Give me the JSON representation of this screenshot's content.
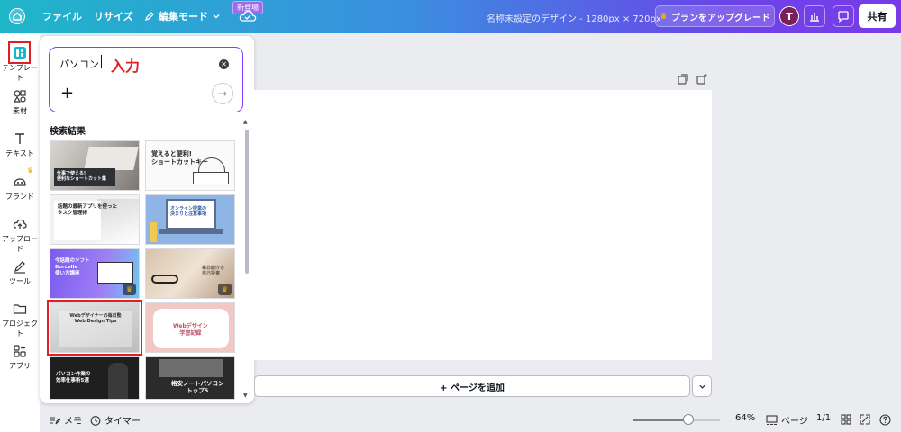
{
  "topbar": {
    "file_label": "ファイル",
    "resize_label": "リサイズ",
    "edit_mode_label": "編集モード",
    "new_badge": "新登場",
    "doc_title": "名称未設定のデザイン - 1280px × 720px",
    "upgrade_label": "プランをアップグレード",
    "avatar_initial": "T",
    "share_label": "共有"
  },
  "rail": {
    "items": [
      {
        "label": "テンプレート",
        "icon": "template-icon",
        "active": true
      },
      {
        "label": "素材",
        "icon": "elements-icon"
      },
      {
        "label": "テキスト",
        "icon": "text-icon"
      },
      {
        "label": "ブランド",
        "icon": "brand-icon"
      },
      {
        "label": "アップロード",
        "icon": "upload-icon"
      },
      {
        "label": "ツール",
        "icon": "tools-icon"
      },
      {
        "label": "プロジェクト",
        "icon": "folder-icon"
      },
      {
        "label": "アプリ",
        "icon": "apps-icon"
      }
    ]
  },
  "panel": {
    "search_value": "パソコン",
    "annotation": "入力",
    "results_heading": "検索結果",
    "thumbs": [
      {
        "text": "仕事で使える!\n便利なショートカット集",
        "theme": "photo-laptop"
      },
      {
        "text": "覚えると便利!\nショートカットキー",
        "theme": "sketch"
      },
      {
        "text": "話題の最新アプリを使った\nタスク管理術",
        "theme": "white-laptop"
      },
      {
        "text": "オンライン授業の\n決まりと注意事項",
        "theme": "blue-laptop"
      },
      {
        "text": "今話題のソフト\nBorcelle\n使い方講座",
        "theme": "purple"
      },
      {
        "text": "毎日続ける\n自己投資",
        "theme": "cafe",
        "crown": true
      },
      {
        "text": "Webデザイナーの毎日塾\nWeb Design Tips",
        "theme": "webdesign",
        "selected": true
      },
      {
        "text": "Webデザイン\n学習記録",
        "theme": "pink"
      },
      {
        "text": "パソコン作業の\n効率仕事術5選",
        "theme": "dark-man"
      },
      {
        "text": "格安ノートパソコン\nトップ5",
        "theme": "dark-laptop"
      }
    ]
  },
  "canvas": {
    "add_page_label": "+ ページを追加"
  },
  "bottombar": {
    "notes_label": "メモ",
    "timer_label": "タイマー",
    "zoom_value": 0.64,
    "zoom_label": "64%",
    "pages_label": "ページ",
    "page_count": "1/1"
  },
  "colors": {
    "accent": "#8b3dff",
    "annotation_red": "#e02020"
  }
}
